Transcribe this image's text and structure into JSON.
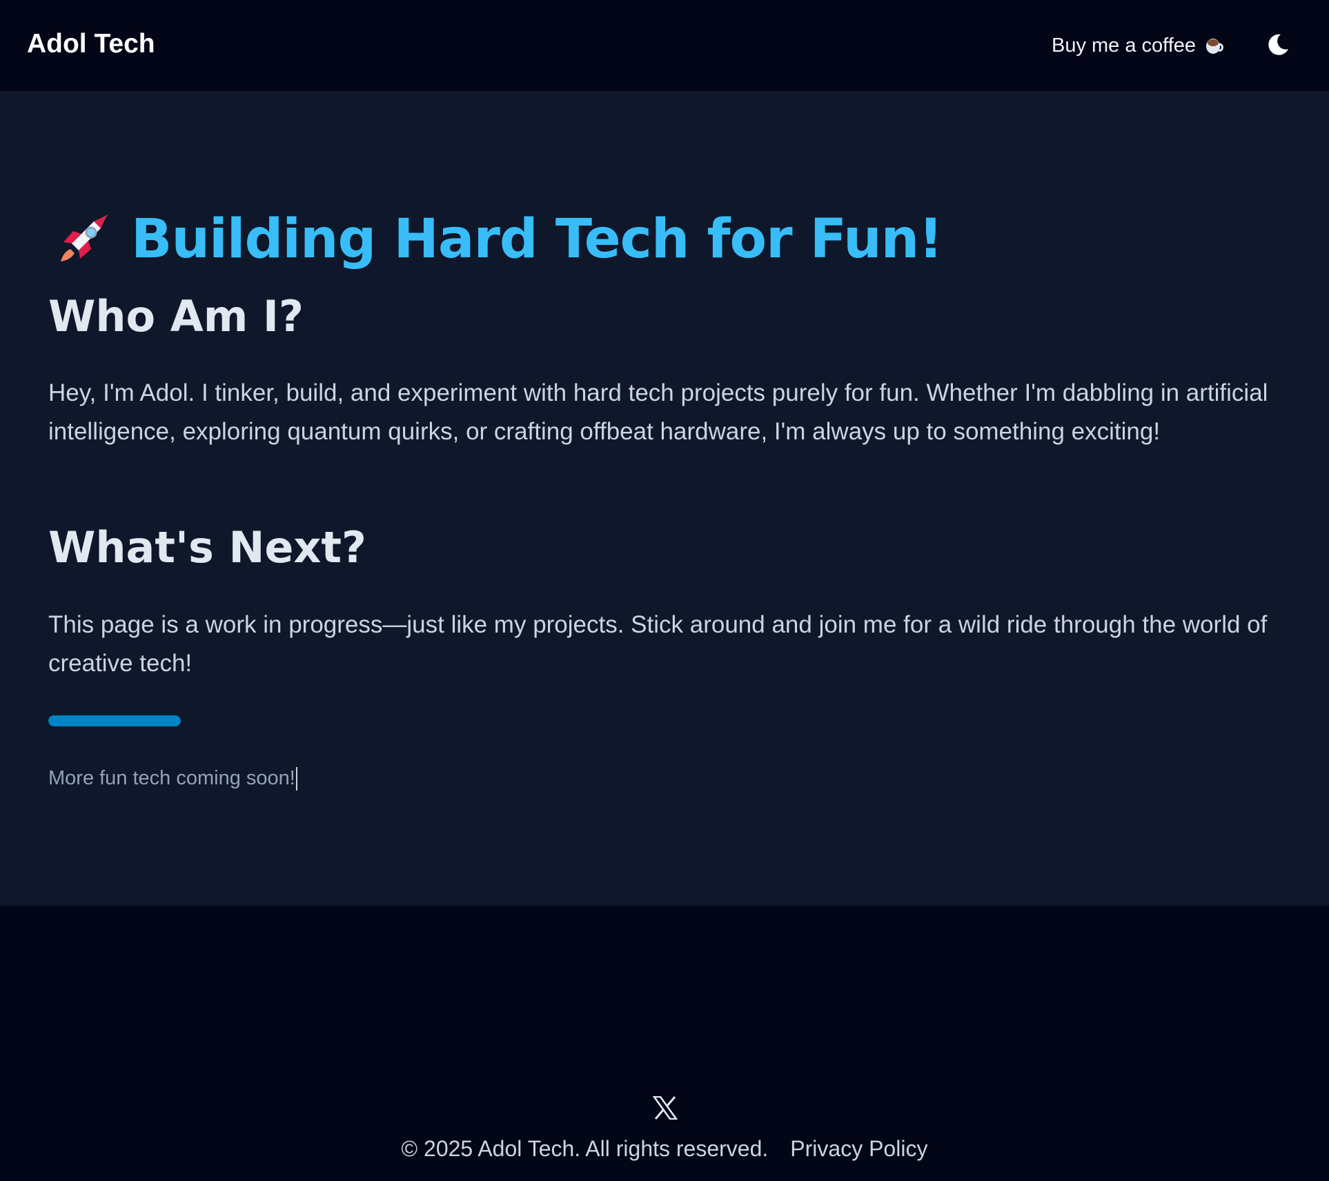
{
  "header": {
    "brand": "Adol Tech",
    "coffee_label": "Buy me a coffee",
    "coffee_icon": "coffee-cup-icon",
    "theme_icon": "moon-icon"
  },
  "hero": {
    "icon": "rocket-icon",
    "title": "Building Hard Tech for Fun!"
  },
  "sections": {
    "who": {
      "heading": "Who Am I?",
      "text": "Hey, I'm Adol. I tinker, build, and experiment with hard tech projects purely for fun. Whether I'm dabbling in artificial intelligence, exploring quantum quirks, or crafting offbeat hardware, I'm always up to something exciting!"
    },
    "next": {
      "heading": "What's Next?",
      "text": "This page is a work in progress—just like my projects. Stick around and join me for a wild ride through the world of creative tech!"
    }
  },
  "progress": {
    "fraction": 1.0,
    "color": "#0284c7"
  },
  "coming_soon": "More fun tech coming soon!",
  "footer": {
    "social_icon": "x-logo-icon",
    "copyright": "© 2025 Adol Tech. All rights reserved.",
    "privacy_label": "Privacy Policy"
  },
  "colors": {
    "accent": "#38bdf8",
    "page_bg": "#0f172a",
    "header_bg": "#020617"
  }
}
